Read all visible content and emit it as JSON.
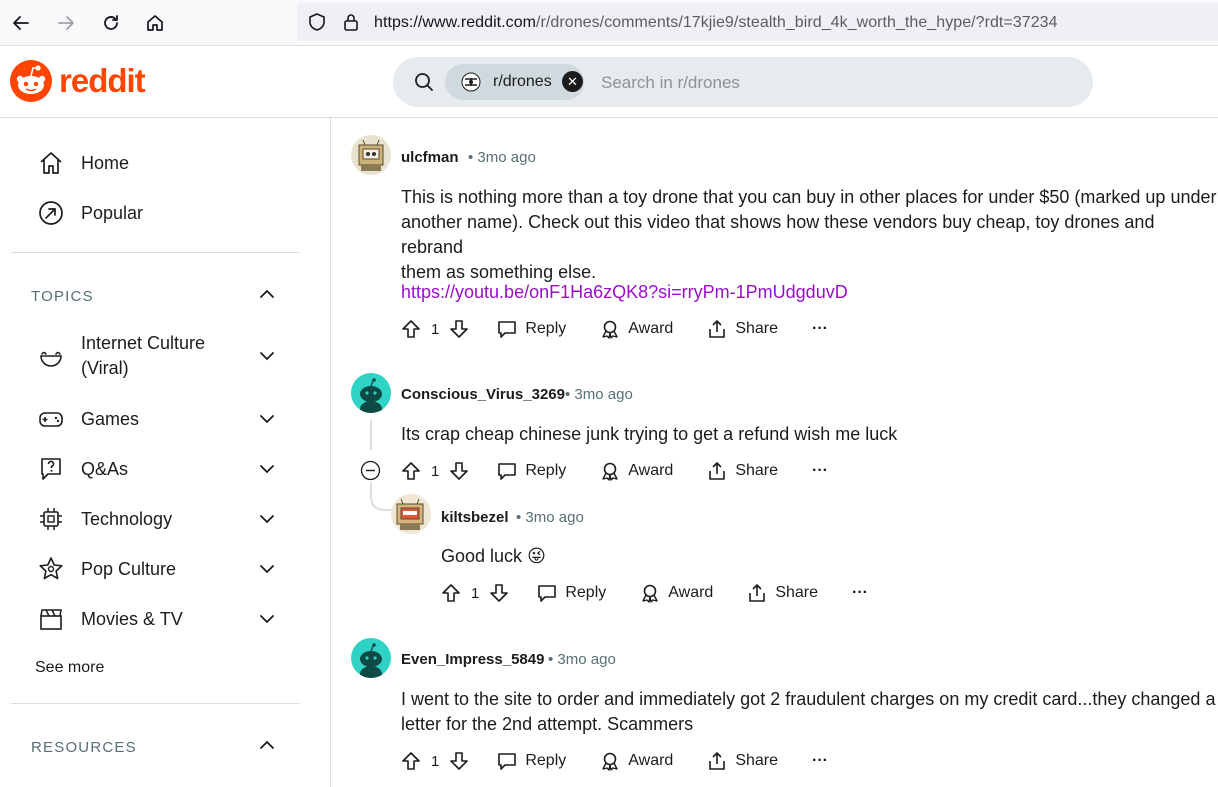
{
  "browser": {
    "url_host": "https://www.reddit.com",
    "url_path": "/r/drones/comments/17kjie9/stealth_bird_4k_worth_the_hype/?rdt=37234"
  },
  "header": {
    "logo_text": "reddit",
    "search_chip": "r/drones",
    "search_placeholder": "Search in r/drones"
  },
  "sidebar": {
    "home": "Home",
    "popular": "Popular",
    "topics_heading": "TOPICS",
    "topics": [
      {
        "label": "Internet Culture\n(Viral)",
        "icon": "smile-icon"
      },
      {
        "label": "Games",
        "icon": "gamepad-icon"
      },
      {
        "label": "Q&As",
        "icon": "question-bubble-icon"
      },
      {
        "label": "Technology",
        "icon": "chip-icon"
      },
      {
        "label": "Pop Culture",
        "icon": "star-icon"
      },
      {
        "label": "Movies & TV",
        "icon": "clapperboard-icon"
      }
    ],
    "see_more": "See more",
    "resources_heading": "RESOURCES"
  },
  "actions": {
    "reply": "Reply",
    "award": "Award",
    "share": "Share",
    "more": "···"
  },
  "comments": [
    {
      "author": "ulcfman",
      "time": "• 3mo ago",
      "lines": [
        "This is nothing more than a toy drone that you can buy in other places for under $50 (marked up under",
        "another name). Check out this video that shows how these vendors buy cheap, toy drones and rebrand",
        "them as something else."
      ],
      "link": "https://youtu.be/onF1Ha6zQK8?si=rryPm-1PmUdgduvD",
      "votes": "1"
    },
    {
      "author": "Conscious_Virus_3269",
      "time": "• 3mo ago",
      "lines": [
        "Its crap cheap chinese junk trying to get a refund wish me luck"
      ],
      "votes": "1"
    },
    {
      "author": "kiltsbezel",
      "time": "• 3mo ago",
      "lines": [
        "Good luck"
      ],
      "emoji": "😜",
      "votes": "1"
    },
    {
      "author": "Even_Impress_5849",
      "time": "• 3mo ago",
      "lines": [
        "I went to the site to order and immediately got 2 fraudulent charges on my credit card...they changed a",
        "letter for the 2nd attempt. Scammers"
      ],
      "votes": "1"
    }
  ],
  "colors": {
    "brand": "#ff4500",
    "link": "#9b0fc9",
    "meta": "#576f76",
    "snoo_teal": "#2ed3c6"
  }
}
